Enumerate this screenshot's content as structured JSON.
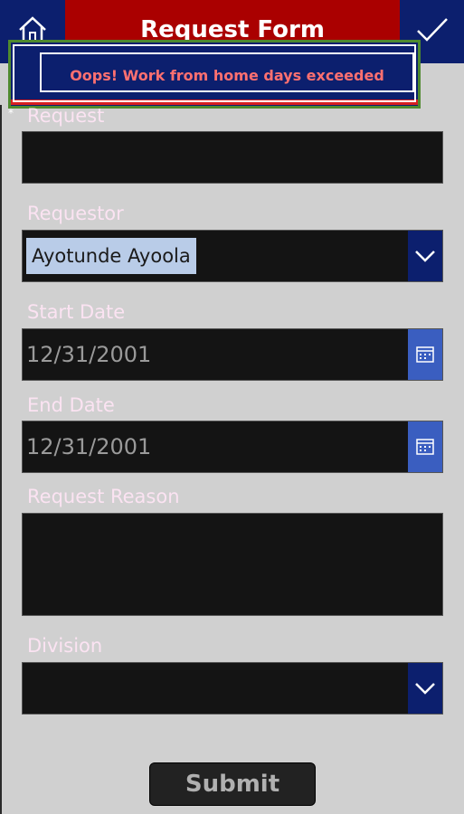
{
  "header": {
    "title": "Request Form",
    "home_icon": "home-icon",
    "confirm_icon": "checkmark-icon"
  },
  "error_banner": {
    "message": "Oops! Work from home days exceeded"
  },
  "form": {
    "request": {
      "label": "Request",
      "value": ""
    },
    "requestor": {
      "label": "Requestor",
      "value": "Ayotunde Ayoola",
      "icon": "chevron-down-icon"
    },
    "start_date": {
      "label": "Start Date",
      "value": "12/31/2001",
      "icon": "calendar-icon"
    },
    "end_date": {
      "label": "End Date",
      "value": "12/31/2001",
      "icon": "calendar-icon"
    },
    "request_reason": {
      "label": "Request Reason",
      "value": ""
    },
    "division": {
      "label": "Division",
      "value": "",
      "icon": "chevron-down-icon"
    },
    "submit_label": "Submit"
  },
  "colors": {
    "header_blue": "#0c1f6e",
    "header_red": "#aa0000",
    "label_pink": "#fbe3f2",
    "error_text": "#ff7070",
    "calendar_blue": "#3a5ec0",
    "chip_blue": "#b9cce8"
  }
}
